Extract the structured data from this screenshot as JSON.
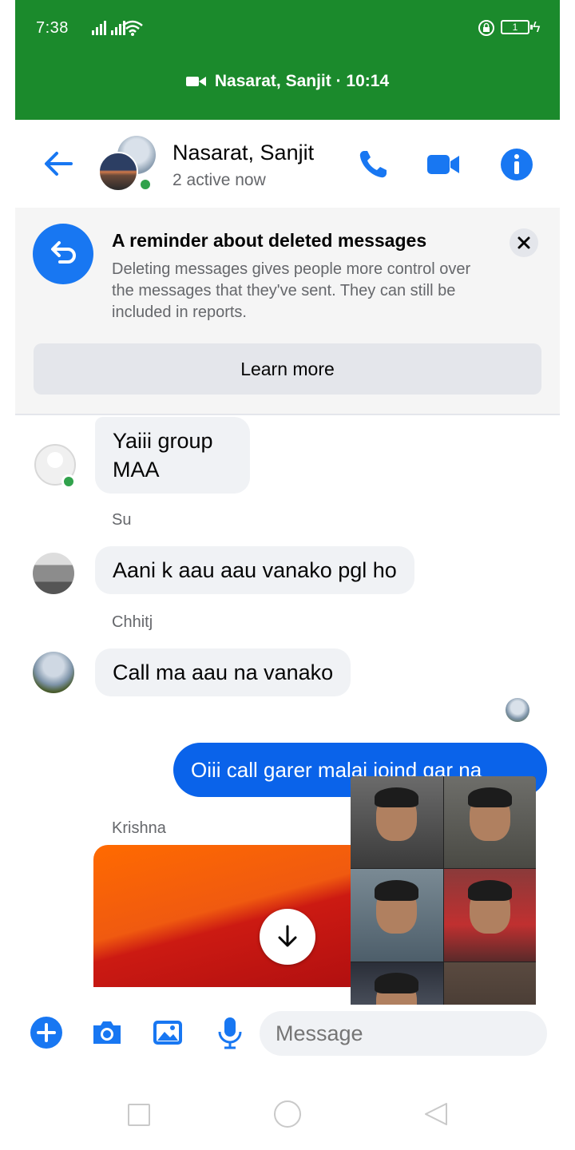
{
  "status_bar": {
    "time": "7:38",
    "battery": "1",
    "icons": [
      "signal-icon",
      "wifi-icon",
      "lock-icon",
      "battery-icon",
      "charging-icon"
    ]
  },
  "call_banner": {
    "text": "Nasarat, Sanjit · 10:14",
    "icon": "video-camera-icon",
    "background": "#1b8a2c"
  },
  "header": {
    "title": "Nasarat, Sanjit",
    "subtitle": "2 active now",
    "icons": [
      "back-arrow-icon",
      "phone-icon",
      "video-camera-icon",
      "info-icon"
    ],
    "accent": "#1877f2"
  },
  "reminder": {
    "title": "A reminder about deleted messages",
    "body": "Deleting messages gives people more control over the messages that they've sent. They can still be included in reports.",
    "button_label": "Learn more",
    "close_icon": "close-icon"
  },
  "messages": [
    {
      "sender": "",
      "text": "Yaiii group MAA",
      "type": "received"
    },
    {
      "sender": "Su",
      "text": "Aani k aau aau vanako pgl ho",
      "type": "received"
    },
    {
      "sender": "Chhitj",
      "text": "Call ma aau na vanako",
      "type": "received"
    },
    {
      "sender": "",
      "text": "Oiii call garer malai joind gar na",
      "type": "sent"
    },
    {
      "sender": "Krishna",
      "text": "",
      "type": "media"
    }
  ],
  "composer": {
    "placeholder": "Message",
    "icons": [
      "plus-icon",
      "camera-icon",
      "gallery-icon",
      "microphone-icon"
    ]
  },
  "colors": {
    "sent_bubble": "#0a63ea",
    "received_bubble": "#f0f2f5",
    "active_dot": "#31a24c"
  }
}
